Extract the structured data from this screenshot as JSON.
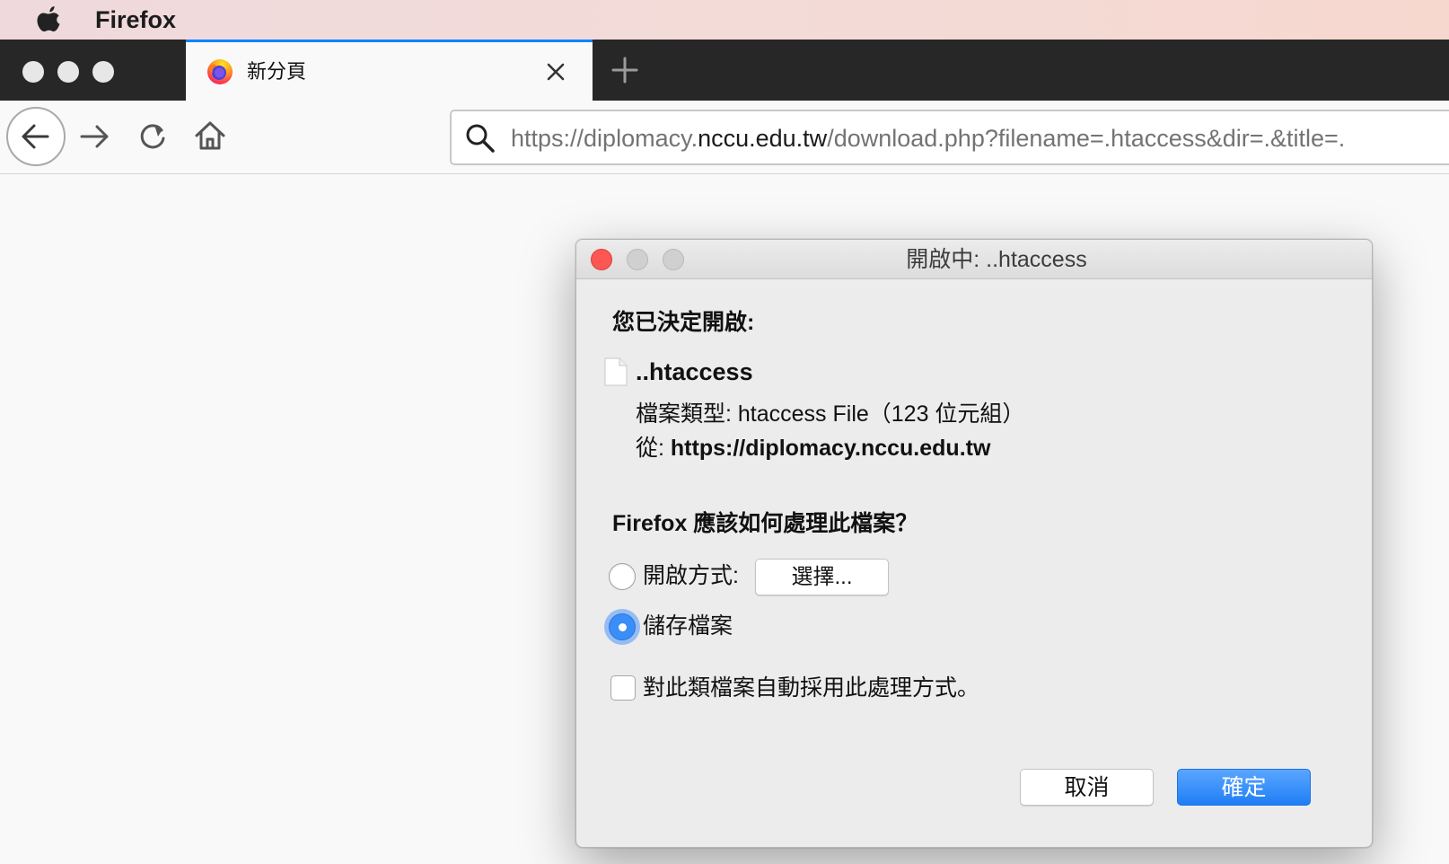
{
  "menubar": {
    "app_name": "Firefox",
    "icon": "apple-icon"
  },
  "tab": {
    "title": "新分頁",
    "favicon": "firefox-icon",
    "close_icon": "close-icon"
  },
  "new_tab_icon": "plus-icon",
  "toolbar": {
    "back_icon": "arrow-left-icon",
    "forward_icon": "arrow-right-icon",
    "reload_icon": "reload-icon",
    "home_icon": "home-icon",
    "url_prefix": "https://diplomacy.",
    "url_domain": "nccu.edu.tw",
    "url_suffix": "/download.php?filename=.htaccess&dir=.&title=."
  },
  "dialog": {
    "title": "開啟中: ..htaccess",
    "decided_label": "您已決定開啟:",
    "filename": "..htaccess",
    "filetype_line": "檔案類型: htaccess File（123 位元組）",
    "from_label": "從:",
    "from_url": "https://diplomacy.nccu.edu.tw",
    "handle_question": "Firefox 應該如何處理此檔案？",
    "open_with_label": "開啟方式:",
    "choose_button": "選擇...",
    "save_file_label": "儲存檔案",
    "selected_option": "儲存檔案",
    "auto_label": "對此類檔案自動採用此處理方式。",
    "auto_checked": false,
    "cancel_button": "取消",
    "ok_button": "確定"
  },
  "colors": {
    "accent": "#0a84ff",
    "ok_button": "#1f7ef5",
    "close_light": "#fc5753",
    "tabstrip": "#272727"
  }
}
